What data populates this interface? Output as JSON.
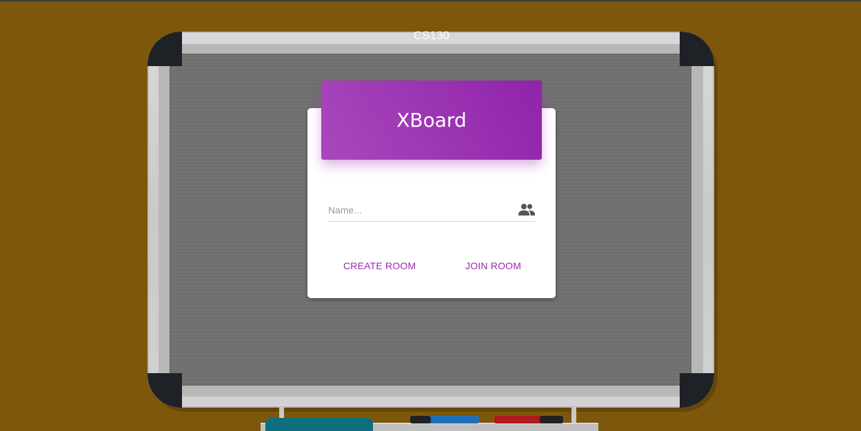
{
  "board": {
    "course_label": "CS130"
  },
  "card": {
    "title": "XBoard",
    "name_field": {
      "value": "",
      "placeholder": "Name...",
      "icon": "people-icon"
    },
    "actions": {
      "create_label": "CREATE ROOM",
      "join_label": "JOIN ROOM"
    }
  },
  "colors": {
    "wall": "#7d570c",
    "accent": "#9c27b0",
    "header_gradient_start": "#ab47bc",
    "header_gradient_end": "#8e24aa"
  }
}
